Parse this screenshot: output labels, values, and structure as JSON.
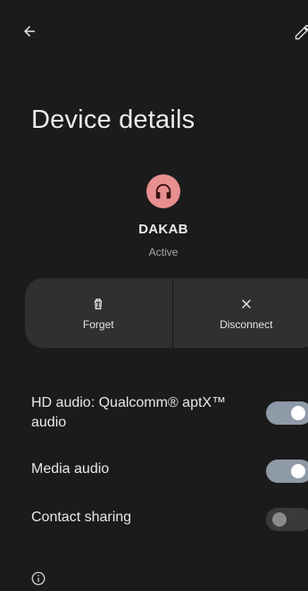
{
  "header": {
    "back_icon": "arrow-back-icon",
    "edit_icon": "pencil-edit-icon"
  },
  "page": {
    "title": "Device details"
  },
  "device": {
    "icon": "headphones-icon",
    "name": "DAKAB",
    "status": "Active",
    "accent_color": "#e88f8f"
  },
  "actions": [
    {
      "icon": "trash-icon",
      "label": "Forget"
    },
    {
      "icon": "close-icon",
      "label": "Disconnect"
    }
  ],
  "settings": [
    {
      "label": "HD audio: Qualcomm® aptX™ audio",
      "enabled": true
    },
    {
      "label": "Media audio",
      "enabled": true
    },
    {
      "label": "Contact sharing",
      "enabled": false
    }
  ],
  "footer": {
    "info_icon": "info-icon"
  },
  "colors": {
    "background": "#1b1b1b",
    "panel": "#303030",
    "toggle_on": "#8f9aa8",
    "toggle_off": "#3a3a3a"
  }
}
